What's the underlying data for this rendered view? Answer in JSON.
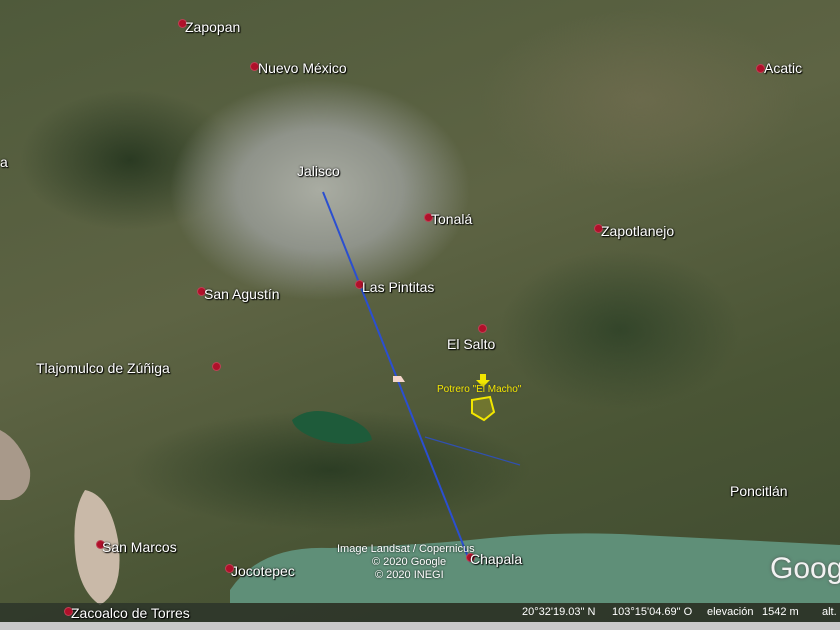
{
  "places": [
    {
      "name": "Zapopan"
    },
    {
      "name": "Nuevo México"
    },
    {
      "name": "Acatic"
    },
    {
      "name": "Jalisco"
    },
    {
      "name": "Tonalá"
    },
    {
      "name": "Zapotlanejo"
    },
    {
      "name": "San Agustín"
    },
    {
      "name": "Las Pintitas"
    },
    {
      "name": "El Salto"
    },
    {
      "name": "Tlajomulco de Zúñiga"
    },
    {
      "name": "Poncitlán"
    },
    {
      "name": "San Marcos"
    },
    {
      "name": "Jocotepec"
    },
    {
      "name": "Chapala"
    },
    {
      "name": "Zacoalco de Torres"
    },
    {
      "name": "a"
    }
  ],
  "placemark": {
    "label": "Potrero \"El Macho\"",
    "color": "#f2e600"
  },
  "path_color": "#2b4fd0",
  "attribution": {
    "line1": "Image Landsat / Copernicus",
    "line2": "© 2020 Google",
    "line3": "© 2020 INEGI"
  },
  "logo": "Google",
  "status": {
    "lat": "20°32'19.03\" N",
    "lon": "103°15'04.69\" O",
    "elev_label": "elevación",
    "elev": "1542 m",
    "alt_label": "alt."
  }
}
